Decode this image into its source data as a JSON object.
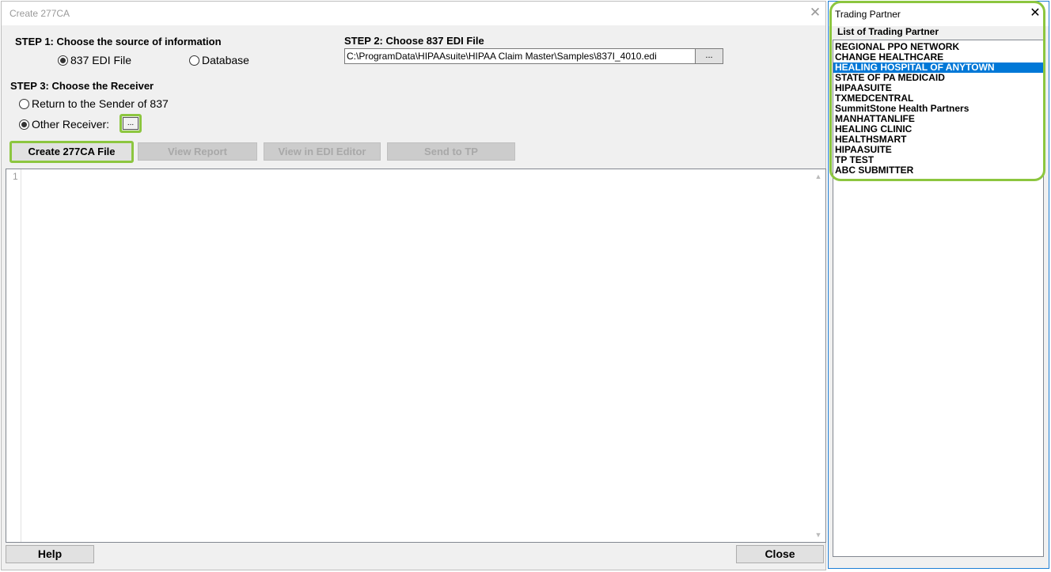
{
  "main": {
    "title": "Create 277CA",
    "close_glyph": "✕",
    "step1": {
      "label": "STEP 1: Choose the source of information",
      "options": [
        {
          "label": "837 EDI File",
          "checked": true
        },
        {
          "label": "Database",
          "checked": false
        }
      ]
    },
    "step2": {
      "label": "STEP 2: Choose 837 EDI File",
      "file_value": "C:\\ProgramData\\HIPAAsuite\\HIPAA Claim Master\\Samples\\837I_4010.edi",
      "browse_label": "..."
    },
    "step3": {
      "label": "STEP 3: Choose the Receiver",
      "options": [
        {
          "label": "Return to the Sender of 837",
          "checked": false
        },
        {
          "label": "Other Receiver:",
          "checked": true
        }
      ],
      "receiver_button_label": "..."
    },
    "actions": {
      "create": "Create 277CA File",
      "view_report": "View Report",
      "view_editor": "View in EDI Editor",
      "send_tp": "Send to TP"
    },
    "editor": {
      "line_number": "1"
    },
    "footer": {
      "help": "Help",
      "close": "Close"
    }
  },
  "trading_partner": {
    "title": "Trading Partner",
    "close_glyph": "✕",
    "group_label": "List of Trading Partner",
    "selected_index": 2,
    "items": [
      "REGIONAL PPO NETWORK",
      "CHANGE HEALTHCARE",
      "HEALING HOSPITAL OF ANYTOWN",
      "STATE OF PA MEDICAID",
      "HIPAASUITE",
      "TXMEDCENTRAL",
      "SummitStone Health Partners",
      "MANHATTANLIFE",
      "HEALING CLINIC",
      "HEALTHSMART",
      "HIPAASUITE",
      "TP TEST",
      "ABC SUBMITTER"
    ]
  },
  "colors": {
    "highlight": "#8cc63f",
    "selection": "#0078d7",
    "panel_border": "#1e7fd6"
  },
  "icons": {
    "close": "close-icon",
    "scroll_up": "chevron-up-icon",
    "scroll_down": "chevron-down-icon"
  }
}
